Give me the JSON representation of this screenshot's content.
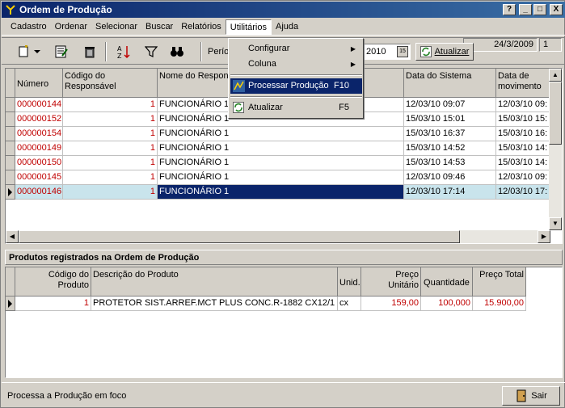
{
  "window": {
    "title": "Ordem de Produção"
  },
  "title_buttons": [
    "?",
    "_",
    "□",
    "X"
  ],
  "menubar": {
    "items": [
      "Cadastro",
      "Ordenar",
      "Selecionar",
      "Buscar",
      "Relatórios",
      "Utilitários",
      "Ajuda"
    ],
    "date": "24/3/2009",
    "number": "1"
  },
  "toolbar": {
    "periodo_label": "Perío",
    "date_value": "2010",
    "atualizar_label": "Atualizar"
  },
  "dropdown": {
    "items": [
      {
        "label": "Configurar",
        "submenu": true
      },
      {
        "label": "Coluna",
        "submenu": true
      },
      {
        "label": "Processar Produção",
        "shortcut": "F10"
      },
      {
        "label": "Atualizar",
        "shortcut": "F5"
      }
    ]
  },
  "orders_grid": {
    "headers": [
      "Número",
      "Código do Responsável",
      "Nome do Responsável",
      "Data do Sistema",
      "Data de movimento"
    ],
    "rows": [
      {
        "numero": "000000144",
        "codigo": "1",
        "nome": "FUNCIONÁRIO 1",
        "data_sistema": "12/03/10  09:07",
        "data_mov": "12/03/10  09:"
      },
      {
        "numero": "000000152",
        "codigo": "1",
        "nome": "FUNCIONÁRIO 1",
        "data_sistema": "15/03/10  15:01",
        "data_mov": "15/03/10  15:"
      },
      {
        "numero": "000000154",
        "codigo": "1",
        "nome": "FUNCIONÁRIO 1",
        "data_sistema": "15/03/10  16:37",
        "data_mov": "15/03/10  16:"
      },
      {
        "numero": "000000149",
        "codigo": "1",
        "nome": "FUNCIONÁRIO 1",
        "data_sistema": "15/03/10  14:52",
        "data_mov": "15/03/10  14:"
      },
      {
        "numero": "000000150",
        "codigo": "1",
        "nome": "FUNCIONÁRIO 1",
        "data_sistema": "15/03/10  14:53",
        "data_mov": "15/03/10  14:"
      },
      {
        "numero": "000000145",
        "codigo": "1",
        "nome": "FUNCIONÁRIO 1",
        "data_sistema": "12/03/10  09:46",
        "data_mov": "12/03/10  09:"
      },
      {
        "numero": "000000146",
        "codigo": "1",
        "nome": "FUNCIONÁRIO 1",
        "data_sistema": "12/03/10  17:14",
        "data_mov": "12/03/10  17:"
      }
    ]
  },
  "products_section": {
    "title": "Produtos registrados na Ordem de Produção"
  },
  "products_grid": {
    "headers": [
      "Código do Produto",
      "Descrição do Produto",
      "Unid.",
      "Preço Unitário",
      "Quantidade",
      "Preço Total"
    ],
    "rows": [
      {
        "codigo": "1",
        "descricao": "PROTETOR SIST.ARREF.MCT PLUS CONC.R-1882 CX12/1",
        "unid": "cx",
        "preco_unit": "159,00",
        "quantidade": "100,000",
        "preco_total": "15.900,00"
      }
    ]
  },
  "status": {
    "text": "Processa a Produção em foco",
    "sair_label": "Sair"
  }
}
